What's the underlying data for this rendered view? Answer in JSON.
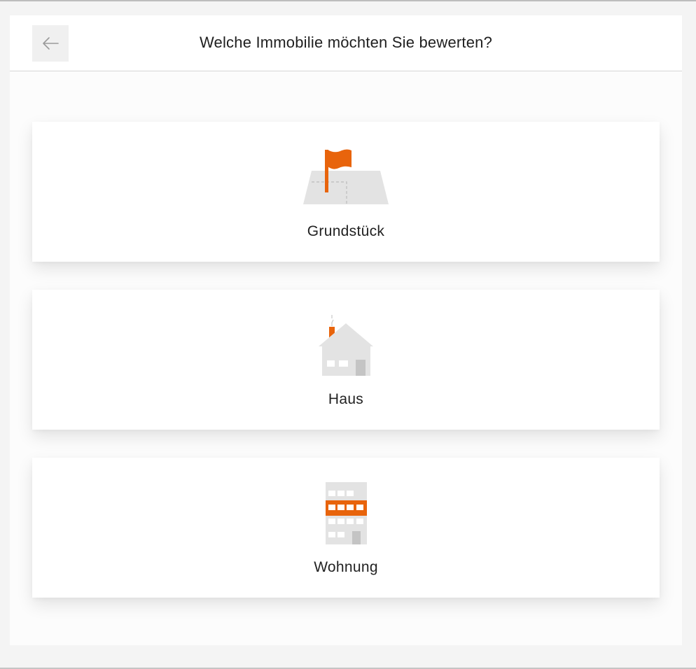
{
  "header": {
    "title": "Welche Immobilie möchten Sie bewerten?",
    "back_icon": "arrow-left-icon"
  },
  "options": [
    {
      "label": "Grundstück",
      "icon": "land-plot-flag-icon"
    },
    {
      "label": "Haus",
      "icon": "house-icon"
    },
    {
      "label": "Wohnung",
      "icon": "apartment-building-icon"
    }
  ],
  "colors": {
    "accent": "#e8640c",
    "icon_gray": "#e3e3e3",
    "icon_dark_gray": "#c4c4c4",
    "background": "#f4f4f4",
    "card": "#ffffff"
  }
}
